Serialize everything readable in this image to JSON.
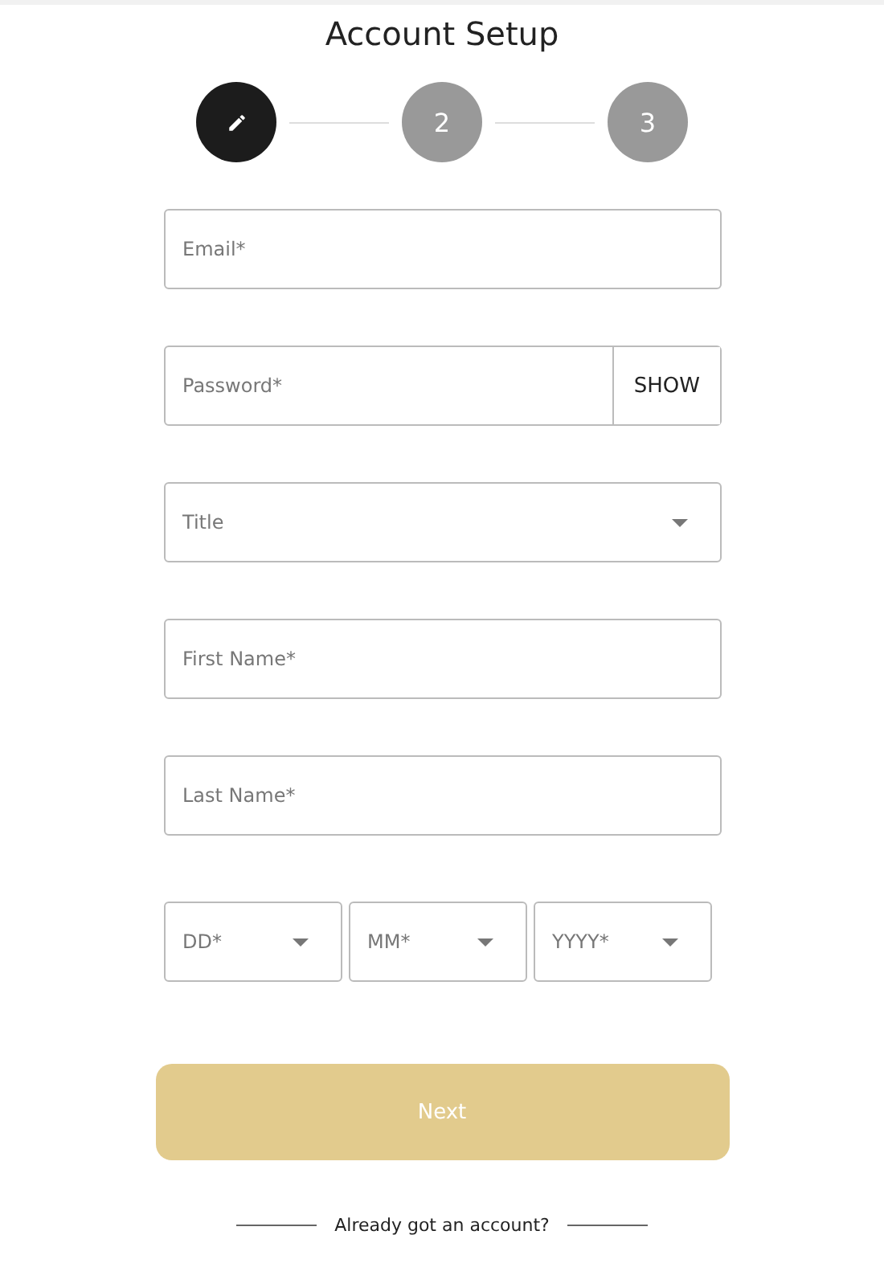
{
  "title": "Account Setup",
  "steps": [
    {
      "kind": "edit",
      "active": true
    },
    {
      "kind": "number",
      "label": "2",
      "active": false
    },
    {
      "kind": "number",
      "label": "3",
      "active": false
    }
  ],
  "fields": [
    {
      "kind": "text",
      "placeholder": "Email*"
    },
    {
      "kind": "password",
      "placeholder": "Password*",
      "toggle": "SHOW"
    },
    {
      "kind": "select",
      "placeholder": "Title"
    },
    {
      "kind": "text",
      "placeholder": "First Name*"
    },
    {
      "kind": "text",
      "placeholder": "Last Name*"
    }
  ],
  "birth_date": [
    {
      "placeholder": "DD*"
    },
    {
      "placeholder": "MM*"
    },
    {
      "placeholder": "YYYY*"
    }
  ],
  "next_button": {
    "label": "Next",
    "disabled": true
  },
  "footer": {
    "text": "Already got an account?"
  }
}
